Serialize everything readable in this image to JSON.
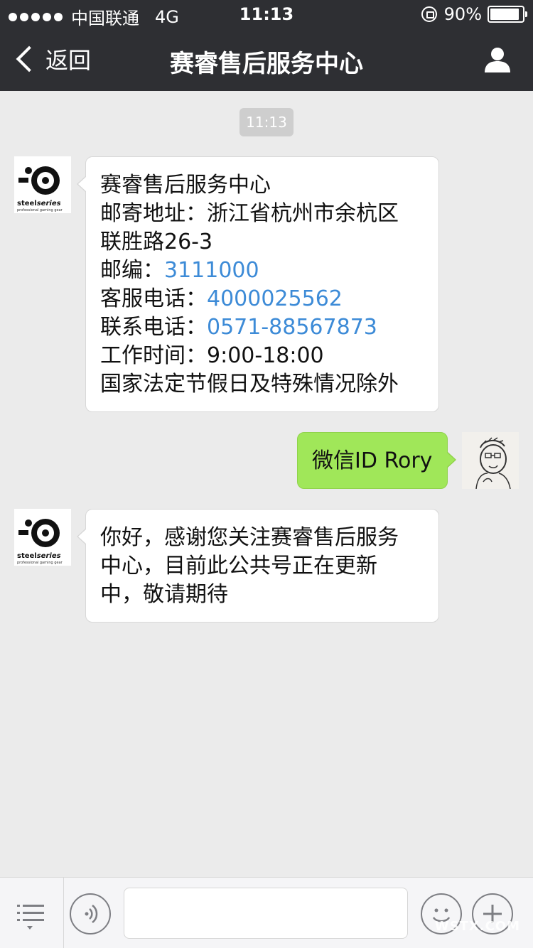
{
  "status_bar": {
    "carrier": "中国联通",
    "network": "4G",
    "time": "11:13",
    "battery_text": "90%",
    "battery_level": 0.9
  },
  "nav": {
    "back_label": "返回",
    "title": "赛睿售后服务中心"
  },
  "chat": {
    "timestamp": "11:13",
    "messages": [
      {
        "sender": "service",
        "lines": [
          {
            "text": "赛睿售后服务中心"
          },
          {
            "text": "邮寄地址：浙江省杭州市余杭区"
          },
          {
            "text": "联胜路26-3"
          },
          {
            "prefix": "邮编：",
            "link": "3111000"
          },
          {
            "prefix": "客服电话：",
            "link": "4000025562"
          },
          {
            "prefix": "联系电话：",
            "link": "0571-88567873"
          },
          {
            "text": "工作时间：9:00-18:00"
          },
          {
            "text": "国家法定节假日及特殊情况除外"
          }
        ]
      },
      {
        "sender": "me",
        "lines": [
          {
            "text": "微信ID Rory"
          }
        ]
      },
      {
        "sender": "service",
        "lines": [
          {
            "text": "你好，感谢您关注赛睿售后服务"
          },
          {
            "text": "中心，目前此公共号正在更新"
          },
          {
            "text": "中，敬请期待"
          }
        ]
      }
    ],
    "avatar_brand": "steelseries",
    "avatar_brand_steel": "steel",
    "avatar_brand_series": "series",
    "avatar_tagline": "professional gaming gear"
  },
  "input_bar": {
    "placeholder": "",
    "watermark_text": "WSTX.COM"
  },
  "icons": {
    "back": "chevron-left-icon",
    "profile": "person-icon",
    "menu": "list-menu-icon",
    "voice": "voice-icon",
    "emoji": "emoji-icon",
    "plus": "plus-icon"
  },
  "colors": {
    "nav_bg": "#2e2f33",
    "chat_bg": "#ebebeb",
    "sent_bubble": "#a0e759",
    "link": "#3d8bd7"
  }
}
